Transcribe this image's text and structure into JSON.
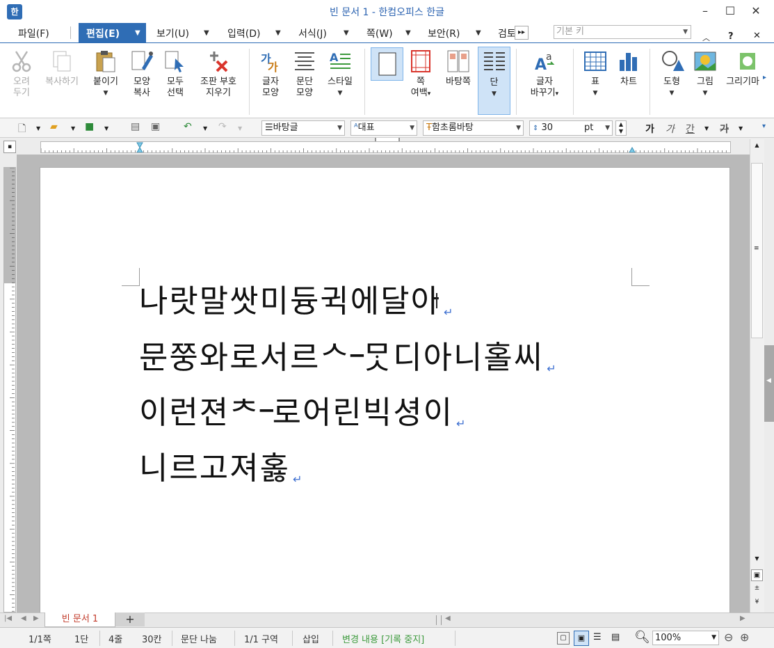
{
  "window": {
    "title": "빈 문서 1 - 한컴오피스 한글",
    "app_icon": "한",
    "controls": {
      "minimize": "–",
      "maximize": "☐",
      "close": "✕"
    }
  },
  "menu": {
    "items": [
      "파일(F)",
      "편집(E)",
      "보기(U)",
      "입력(D)",
      "서식(J)",
      "쪽(W)",
      "보안(R)",
      "검토"
    ],
    "active": "편집(E)",
    "style_placeholder": "기본 키",
    "help": "?"
  },
  "ribbon": {
    "cut": [
      "오려",
      "두기"
    ],
    "copy": "복사하기",
    "paste": "붙이기",
    "format_copy": [
      "모양",
      "복사"
    ],
    "select_all": [
      "모두",
      "선택"
    ],
    "clear_marks": [
      "조판 부호",
      "지우기"
    ],
    "char_shape": [
      "글자",
      "모양"
    ],
    "para_shape": [
      "문단",
      "모양"
    ],
    "style": "스타일",
    "page_margin": [
      "쪽",
      "여백"
    ],
    "master_page": "바탕쪽",
    "columns": "단",
    "char_replace": [
      "글자",
      "바꾸기"
    ],
    "table": "표",
    "chart": "차트",
    "shape": "도형",
    "picture": "그림",
    "drawing": "그리기마"
  },
  "toolbar": {
    "style_value": "바탕글",
    "lang_value": "대표",
    "font_value": "함초롬바탕",
    "size_value": "30",
    "size_unit": "pt",
    "bold": "가",
    "italic": "가",
    "underline": "간",
    "strike": "가"
  },
  "document": {
    "lines": [
      "나랏말쌋미듕귁에달아",
      "문쭝와로서르ᄉ᠆ᄆᆞᆺ디아니홀씨",
      "이런젼ᄎ᠆로어린빅셩이",
      "니르고져홇"
    ]
  },
  "tabs": {
    "doc_tab": "빈 문서 1",
    "add": "+"
  },
  "status": {
    "page": "1/1쪽",
    "column": "1단",
    "line": "4줄",
    "col": "30칸",
    "para": "문단 나눔",
    "section": "1/1 구역",
    "insert": "삽입",
    "track": "변경 내용 [기록 중지]",
    "zoom": "100%"
  },
  "colors": {
    "accent": "#2f6db5",
    "track_green": "#3c9a3c",
    "tab_red": "#c23a2a"
  }
}
